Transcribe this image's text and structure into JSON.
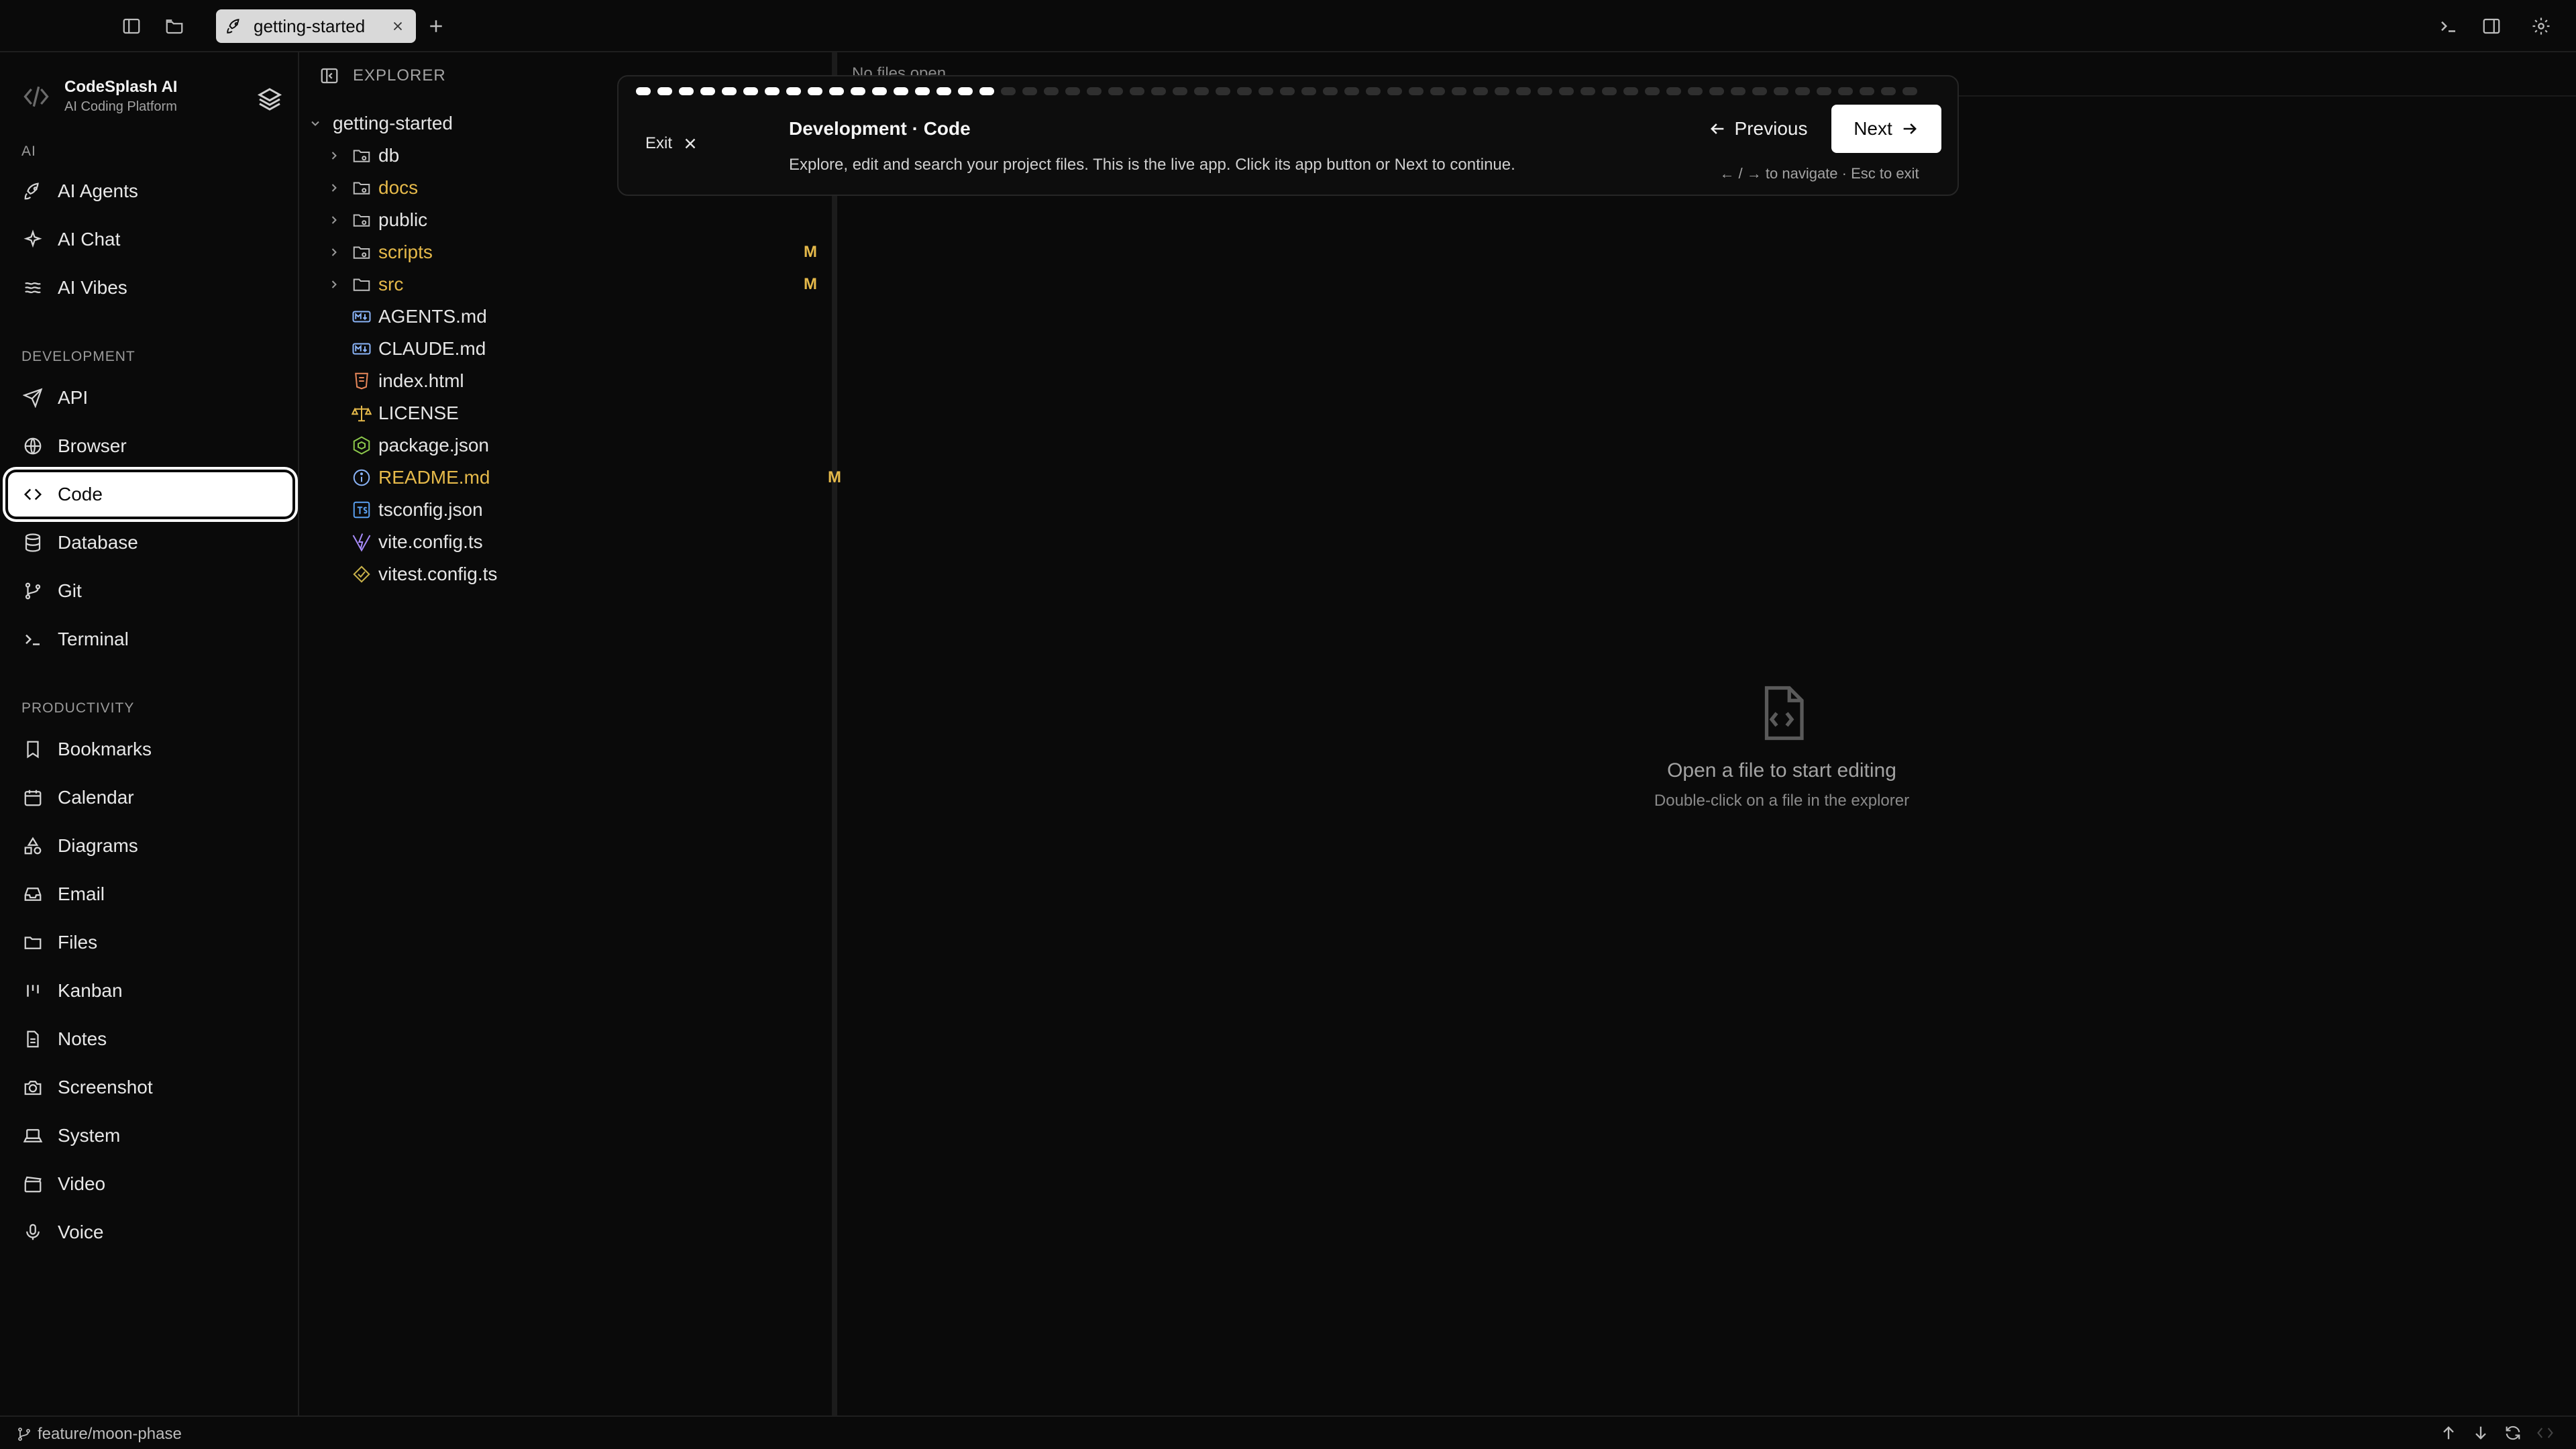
{
  "topbar": {
    "tab_label": "getting-started"
  },
  "sidebar": {
    "brand_name": "CodeSplash AI",
    "brand_sub": "AI Coding Platform",
    "sections": {
      "ai": "AI",
      "development": "DEVELOPMENT",
      "productivity": "PRODUCTIVITY"
    },
    "ai_items": [
      "AI Agents",
      "AI Chat",
      "AI Vibes"
    ],
    "dev_items": [
      "API",
      "Browser",
      "Code",
      "Database",
      "Git",
      "Terminal"
    ],
    "prod_items": [
      "Bookmarks",
      "Calendar",
      "Diagrams",
      "Email",
      "Files",
      "Kanban",
      "Notes",
      "Screenshot",
      "System",
      "Video",
      "Voice"
    ],
    "active": "Code"
  },
  "explorer": {
    "title": "EXPLORER",
    "root": "getting-started",
    "items": [
      {
        "name": "db",
        "type": "folder",
        "modified": false
      },
      {
        "name": "docs",
        "type": "folder",
        "modified": true,
        "badge": ""
      },
      {
        "name": "public",
        "type": "folder",
        "modified": false
      },
      {
        "name": "scripts",
        "type": "folder",
        "modified": true,
        "badge": "M"
      },
      {
        "name": "src",
        "type": "folder",
        "modified": true,
        "badge": "M"
      },
      {
        "name": "AGENTS.md",
        "type": "md",
        "modified": false
      },
      {
        "name": "CLAUDE.md",
        "type": "md",
        "modified": false
      },
      {
        "name": "index.html",
        "type": "html",
        "modified": false
      },
      {
        "name": "LICENSE",
        "type": "license",
        "modified": false
      },
      {
        "name": "package.json",
        "type": "json",
        "modified": false
      },
      {
        "name": "README.md",
        "type": "info",
        "modified": true,
        "badge": "M"
      },
      {
        "name": "tsconfig.json",
        "type": "ts",
        "modified": false
      },
      {
        "name": "vite.config.ts",
        "type": "vite",
        "modified": false
      },
      {
        "name": "vitest.config.ts",
        "type": "vitest",
        "modified": false
      }
    ]
  },
  "editor": {
    "no_files": "No files open",
    "empty_title": "Open a file to start editing",
    "empty_sub": "Double-click on a file in the explorer"
  },
  "tour": {
    "exit_label": "Exit",
    "title": "Development · Code",
    "description": "Explore, edit and search your project files. This is the live app. Click its app button or Next to continue.",
    "prev_label": "Previous",
    "next_label": "Next",
    "hint": "← / → to navigate · Esc to exit",
    "progress": {
      "completed": 17,
      "total": 60
    }
  },
  "statusbar": {
    "branch": "feature/moon-phase"
  },
  "colors": {
    "background": "#0a0a0a",
    "modified": "#e5b94a",
    "active_bg": "#ffffff"
  }
}
